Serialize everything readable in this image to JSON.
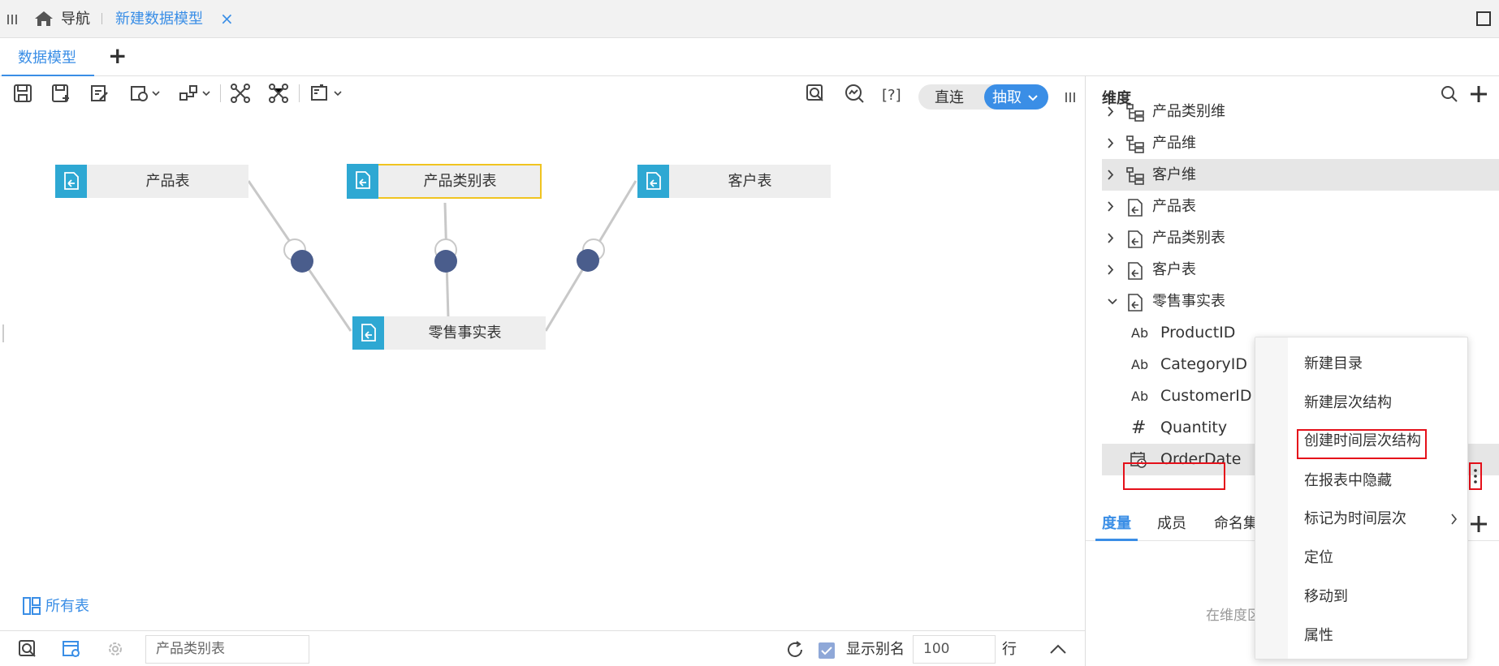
{
  "topbar": {
    "nav_label": "导航",
    "tab_title": "新建数据模型",
    "close_glyph": "×"
  },
  "tabs": {
    "active": "数据模型",
    "add": "+"
  },
  "toolbar": {
    "mode_direct": "直连",
    "mode_extract": "抽取",
    "bracket_help": "[?]"
  },
  "canvas": {
    "tables": [
      {
        "label": "产品表"
      },
      {
        "label": "产品类别表"
      },
      {
        "label": "客户表"
      },
      {
        "label": "零售事实表"
      }
    ],
    "all_tables": "所有表"
  },
  "statusbar": {
    "table_input_value": "产品类别表",
    "show_alias": "显示别名",
    "row_count": "100",
    "row_unit": "行"
  },
  "right_panel": {
    "title": "维度",
    "tree": [
      {
        "label": "产品类别维"
      },
      {
        "label": "产品维"
      },
      {
        "label": "客户维"
      },
      {
        "label": "产品表"
      },
      {
        "label": "产品类别表"
      },
      {
        "label": "客户表"
      },
      {
        "label": "零售事实表"
      }
    ],
    "fields": [
      {
        "icon": "Ab",
        "label": "ProductID"
      },
      {
        "icon": "Ab",
        "label": "CategoryID"
      },
      {
        "icon": "Ab",
        "label": "CustomerID"
      },
      {
        "icon": "#",
        "label": "Quantity"
      },
      {
        "icon": "date",
        "label": "OrderDate"
      }
    ],
    "bottom_tabs": [
      "度量",
      "成员",
      "命名集"
    ],
    "empty_hint": "在维度区"
  },
  "context_menu": {
    "items": [
      "新建目录",
      "新建层次结构",
      "创建时间层次结构",
      "在报表中隐藏",
      "标记为时间层次",
      "定位",
      "移动到",
      "属性"
    ]
  },
  "colors": {
    "accent": "#3a8ee6",
    "table_icon": "#2ea8d3",
    "selected_border": "#f0c420",
    "join_node": "#4a5d8c",
    "highlight": "#e5101a"
  }
}
